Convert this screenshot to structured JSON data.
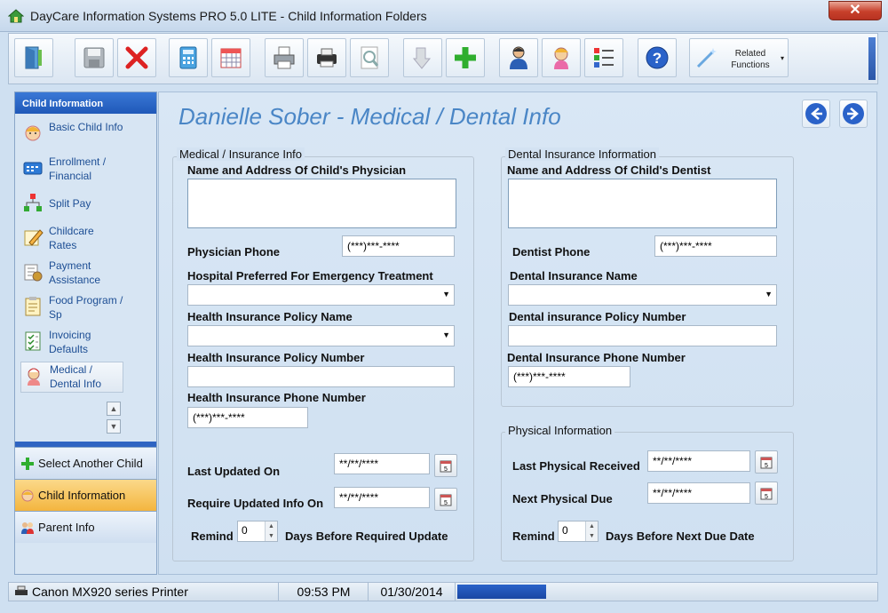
{
  "window": {
    "title": "DayCare Information Systems PRO 5.0 LITE - Child Information Folders",
    "close_label": "✕"
  },
  "toolbar": {
    "buttons": [
      "exit-icon",
      "save-icon",
      "delete-icon",
      "calculator-icon",
      "calendar-icon",
      "print-icon",
      "printer-icon",
      "preview-icon",
      "import-icon",
      "add-icon",
      "person-icon",
      "child-icon",
      "checklist-icon",
      "help-icon"
    ],
    "related_label": "Related Functions",
    "related_arrow": "▾"
  },
  "sidebar": {
    "header": "Child Information",
    "items": [
      {
        "label": "Basic Child Info",
        "icon": "child-face-icon"
      },
      {
        "label": "Enrollment / Financial",
        "icon": "enrollment-card-icon"
      },
      {
        "label": "Split Pay",
        "icon": "split-tree-icon"
      },
      {
        "label": "Childcare Rates",
        "icon": "rates-pencil-icon"
      },
      {
        "label": "Payment Assistance",
        "icon": "payment-icon"
      },
      {
        "label": "Food Program / Sp",
        "icon": "food-clipboard-icon"
      },
      {
        "label": "Invoicing Defaults",
        "icon": "invoice-check-icon"
      },
      {
        "label": "Medical / Dental Info",
        "icon": "nurse-icon"
      }
    ],
    "scroll_up": "▲",
    "scroll_down": "▼",
    "nav": [
      {
        "label": "Select Another Child",
        "icon": "plus-icon"
      },
      {
        "label": "Child Information",
        "icon": "child-face-icon"
      },
      {
        "label": "Parent Info",
        "icon": "parents-icon"
      }
    ]
  },
  "main": {
    "title": "Danielle Sober - Medical / Dental Info",
    "medical": {
      "group_title": "Medical / Insurance Info",
      "physician_label": "Name and Address Of Child's Physician",
      "physician_value": "",
      "phone_label": "Physician Phone",
      "phone_value": "(***)***-****",
      "hospital_label": "Hospital Preferred For Emergency Treatment",
      "hospital_value": "",
      "policy_name_label": "Health Insurance Policy Name",
      "policy_name_value": "",
      "policy_number_label": "Health Insurance Policy Number",
      "policy_number_value": "",
      "ins_phone_label": "Health Insurance Phone Number",
      "ins_phone_value": "(***)***-****",
      "last_updated_label": "Last Updated On",
      "last_updated_value": "**/**/****",
      "require_label": "Require Updated Info On",
      "require_value": "**/**/****",
      "remind_label": "Remind",
      "remind_value": "0",
      "remind_suffix": "Days Before Required Update"
    },
    "dental": {
      "group_title": "Dental Insurance Information",
      "dentist_label": "Name and Address Of Child's Dentist",
      "dentist_value": "",
      "phone_label": "Dentist  Phone",
      "phone_value": "(***)***-****",
      "ins_name_label": "Dental Insurance Name",
      "ins_name_value": "",
      "policy_number_label": "Dental insurance Policy Number",
      "policy_number_value": "",
      "ins_phone_label": "Dental Insurance Phone Number",
      "ins_phone_value": "(***)***-****"
    },
    "physical": {
      "group_title": "Physical Information",
      "last_label": "Last Physical Received",
      "last_value": "**/**/****",
      "next_label": "Next Physical Due",
      "next_value": "**/**/****",
      "remind_label": "Remind",
      "remind_value": "0",
      "remind_suffix": "Days Before Next Due Date"
    }
  },
  "status": {
    "printer": "Canon MX920 series Printer",
    "time": "09:53 PM",
    "date": "01/30/2014"
  },
  "colors": {
    "accent": "#2a62c9",
    "title": "#4a86c6",
    "current_nav": "#f3b53f"
  }
}
